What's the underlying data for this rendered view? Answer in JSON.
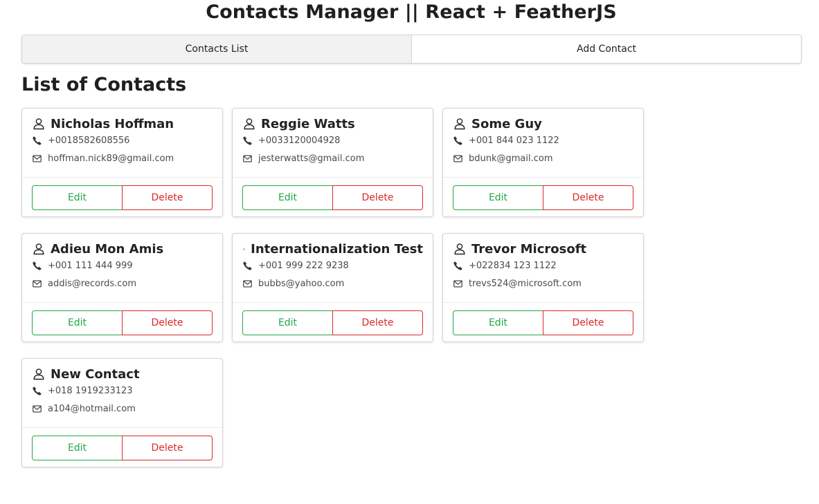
{
  "app": {
    "title": "Contacts Manager || React + FeatherJS"
  },
  "menu": {
    "items": [
      {
        "label": "Contacts List",
        "active": true
      },
      {
        "label": "Add Contact",
        "active": false
      }
    ]
  },
  "main": {
    "heading": "List of Contacts",
    "edit_label": "Edit",
    "delete_label": "Delete",
    "contacts": [
      {
        "name": "Nicholas Hoffman",
        "phone": "+0018582608556",
        "email": "hoffman.nick89@gmail.com"
      },
      {
        "name": "Reggie Watts",
        "phone": "+0033120004928",
        "email": "jesterwatts@gmail.com"
      },
      {
        "name": "Some Guy",
        "phone": "+001 844 023 1122",
        "email": "bdunk@gmail.com"
      },
      {
        "name": "Adieu Mon Amis",
        "phone": "+001 111 444 999",
        "email": "addis@records.com"
      },
      {
        "name": "Internationalization Test",
        "phone": "+001 999 222 9238",
        "email": "bubbs@yahoo.com"
      },
      {
        "name": "Trevor Microsoft",
        "phone": "+022834 123 1122",
        "email": "trevs524@microsoft.com"
      },
      {
        "name": "New Contact",
        "phone": "+018 1919233123",
        "email": "a104@hotmail.com"
      }
    ]
  },
  "colors": {
    "edit": "#21a744",
    "delete": "#db2828",
    "active_tab": "#f2f2f2"
  },
  "icons": {
    "contact": "user-outline-icon",
    "phone": "phone-icon",
    "email": "envelope-outline-icon"
  }
}
